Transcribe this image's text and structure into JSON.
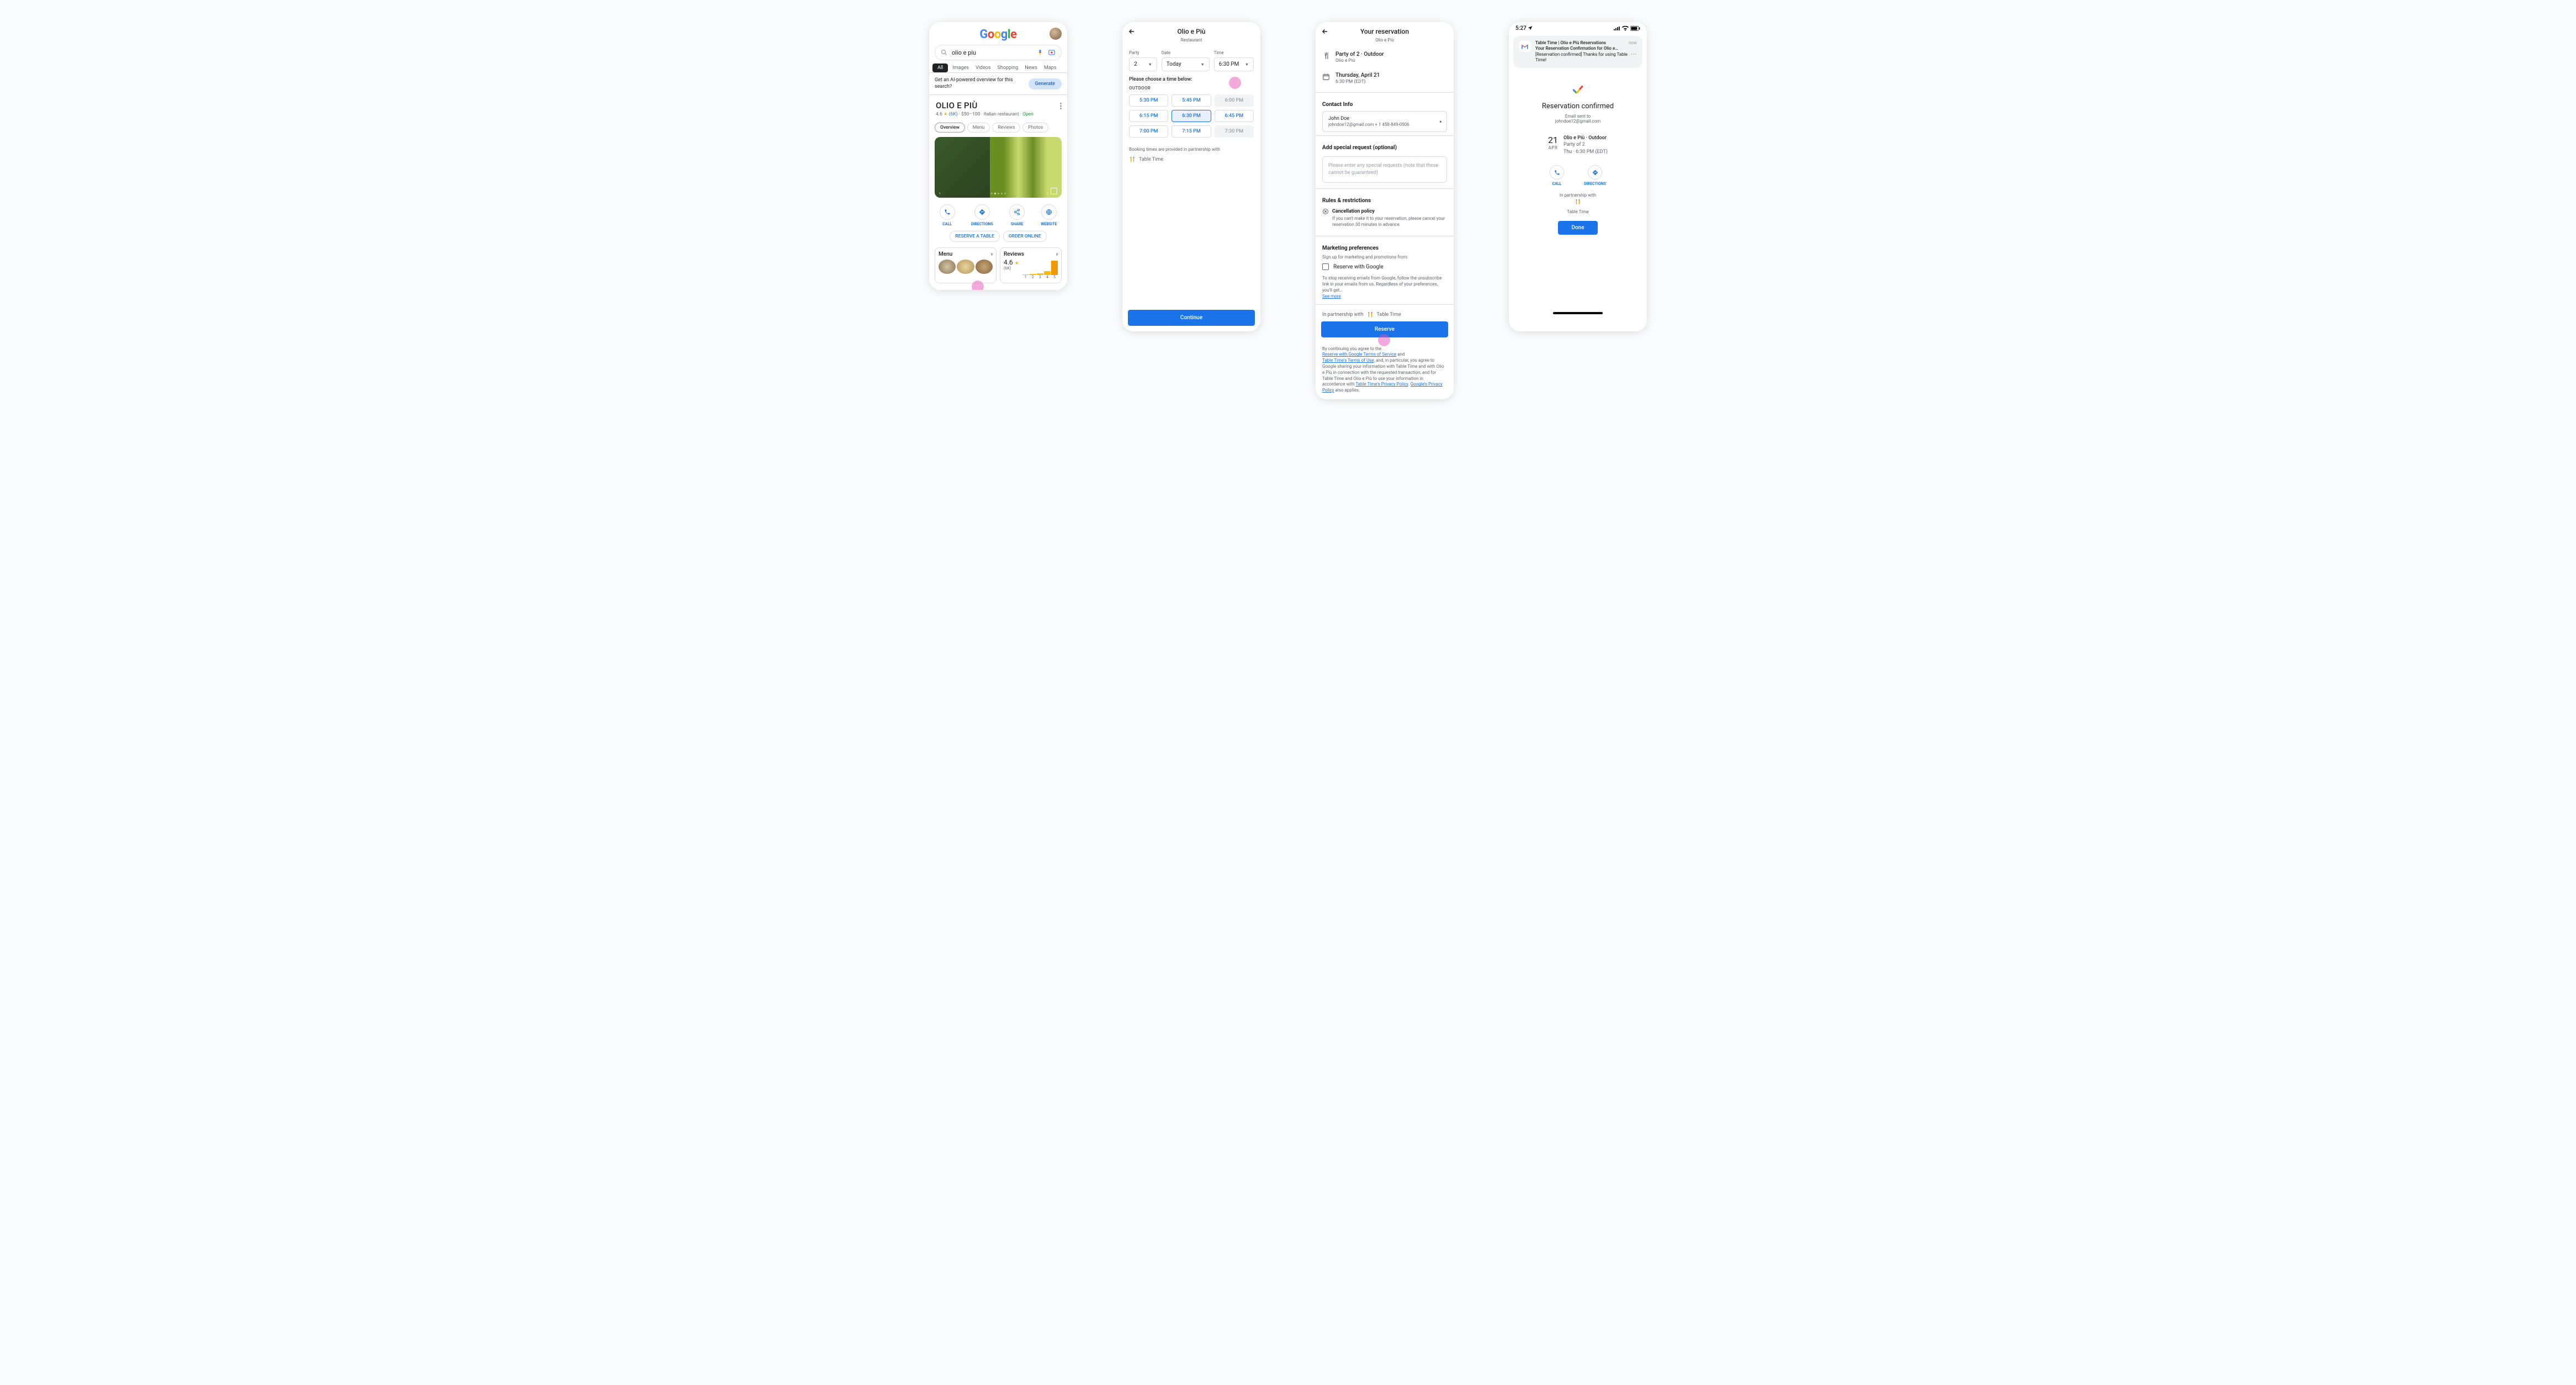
{
  "p1": {
    "query": "olio e piu",
    "tabs": [
      "All",
      "Images",
      "Videos",
      "Shopping",
      "News",
      "Maps"
    ],
    "ai_prompt": "Get an AI-powered overview for this search?",
    "ai_btn": "Generate",
    "name": "OLIO E PIÙ",
    "rating": "4.6",
    "rating_count": "(6K)",
    "price": "$50–100",
    "cat": "Italian restaurant",
    "open": "Open",
    "ktabs": [
      "Overview",
      "Menu",
      "Reviews",
      "Photos"
    ],
    "actions": [
      "CALL",
      "DIRECTIONS",
      "SHARE",
      "WEBSITE"
    ],
    "cta": [
      "RESERVE A TABLE",
      "ORDER ONLINE"
    ],
    "menu_h": "Menu",
    "rev_h": "Reviews",
    "rev_r": "4.6",
    "rev_c": "(6K)",
    "hist_x": [
      "1",
      "2",
      "3",
      "4",
      "5"
    ]
  },
  "p2": {
    "title": "Olio e Più",
    "sub": "Restaurant",
    "labels": {
      "party": "Party",
      "date": "Date",
      "time": "Time"
    },
    "party": "2",
    "date": "Today",
    "time": "6:30 PM",
    "prompt": "Please choose a time below:",
    "section": "OUTDOOR",
    "slots": [
      {
        "t": "5:30 PM",
        "d": false
      },
      {
        "t": "5:45 PM",
        "d": false
      },
      {
        "t": "6:00 PM",
        "d": true
      },
      {
        "t": "6:15 PM",
        "d": false
      },
      {
        "t": "6:30 PM",
        "d": false,
        "sel": true
      },
      {
        "t": "6:45 PM",
        "d": false
      },
      {
        "t": "7:00 PM",
        "d": false
      },
      {
        "t": "7:15 PM",
        "d": false
      },
      {
        "t": "7:30 PM",
        "d": true
      }
    ],
    "note": "Booking times are provided in partnership with",
    "partner": "Table Time",
    "btn": "Continue"
  },
  "p3": {
    "title": "Your reservation",
    "sub": "Olio e Più",
    "party_line": "Party of 2 · Outdoor",
    "rest": "Olio e Più",
    "date_line": "Thursday, April 21",
    "time_line": "6:30 PM (EDT)",
    "ci_h": "Contact Info",
    "name": "John Doe",
    "contact": "johndoe12@gmail.com   + 1 458-849-0506",
    "sr_h": "Add special request (optional)",
    "sr_ph": "Please enter any special requests (note that these cannot be guaranteed)",
    "rr_h": "Rules & restrictions",
    "cp_h": "Cancellation policy",
    "cp_d": "If you can't make it to your reservation, please cancel your reservation 30 minutes in advance.",
    "mp_h": "Marketing preferences",
    "mp_d": "Sign up for marketing and promotions from:",
    "mp_ck": "Reserve with Google",
    "mp_fine": "To stop receiving emails from Google, follow the unsubscribe link in your emails from us. Regardless of your preferences, you'll get…",
    "see_more": "See more",
    "ip": "In partnership with",
    "partner": "Table Time",
    "btn": "Reserve",
    "agree": "By continuing you agree to the",
    "tos1": "Reserve with Google Terms of Service",
    "and": "and",
    "tos2": "Table Time's Terms of Use",
    "agree2": ", and, in particular, you agree to Google sharing your information with  Table Time and with Olio e Più in connection with the requested transaction, and for Table Time  and Olio e Più to use your information in accordance with",
    "pp1": "Table Time's Privacy Policy",
    "dot": ". ",
    "pp2": "Google's Privacy Policy",
    "agree3": " also applies."
  },
  "p4": {
    "clock": "5:27",
    "notif_t": "Table Time | Olio e Più Reservations",
    "notif_now": "now",
    "notif_s": "Your Reservation Confirmation for Olio e…",
    "notif_b": "[Reservation confirmed] Thanks for using Table Time!",
    "conf": "Reservation confirmed",
    "sent": "Email sent to",
    "email": "johndoe12@gmail.com",
    "day": "21",
    "mon": "APR",
    "r1": "Olio e Più · Outdoor",
    "r2": "Party of 2",
    "r3": "Thu · 6:30 PM (EDT)",
    "actions": [
      "CALL",
      "DIRECTIONS"
    ],
    "ip": "In partnership with",
    "partner": "Table Time",
    "btn": "Done"
  }
}
